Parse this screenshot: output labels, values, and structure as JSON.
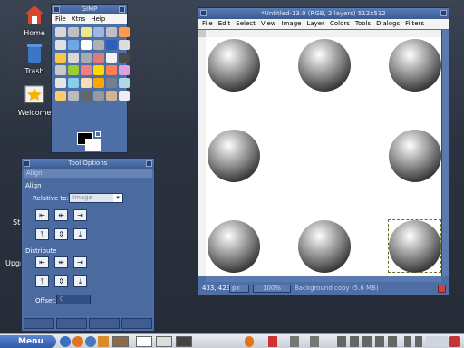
{
  "desktop": {
    "icons": [
      {
        "label": "Home",
        "icon": "home-icon"
      },
      {
        "label": "Trash",
        "icon": "trash-icon"
      },
      {
        "label": "Welcome",
        "icon": "welcome-icon"
      }
    ],
    "partial_labels": [
      "St",
      "Upgr"
    ]
  },
  "toolbox": {
    "title": "GIMP",
    "menu": [
      "File",
      "Xtns",
      "Help"
    ],
    "tool_count": 36
  },
  "tool_options": {
    "title": "Tool Options",
    "tab_label": "Align",
    "section_align": "Align",
    "relative_to_label": "Relative to:",
    "relative_to_value": "Image",
    "section_distribute": "Distribute",
    "offset_label": "Offset:",
    "offset_value": "0"
  },
  "image_window": {
    "title": "*Untitled-13.0 (RGB, 2 layers) 512x512",
    "menu": [
      "File",
      "Edit",
      "Select",
      "View",
      "Image",
      "Layer",
      "Colors",
      "Tools",
      "Dialogs",
      "Filters"
    ],
    "coords": "433, 429",
    "unit": "px",
    "zoom": "100%",
    "status": "Background copy (5.6 MB)"
  },
  "taskbar": {
    "menu_label": "Menu"
  }
}
